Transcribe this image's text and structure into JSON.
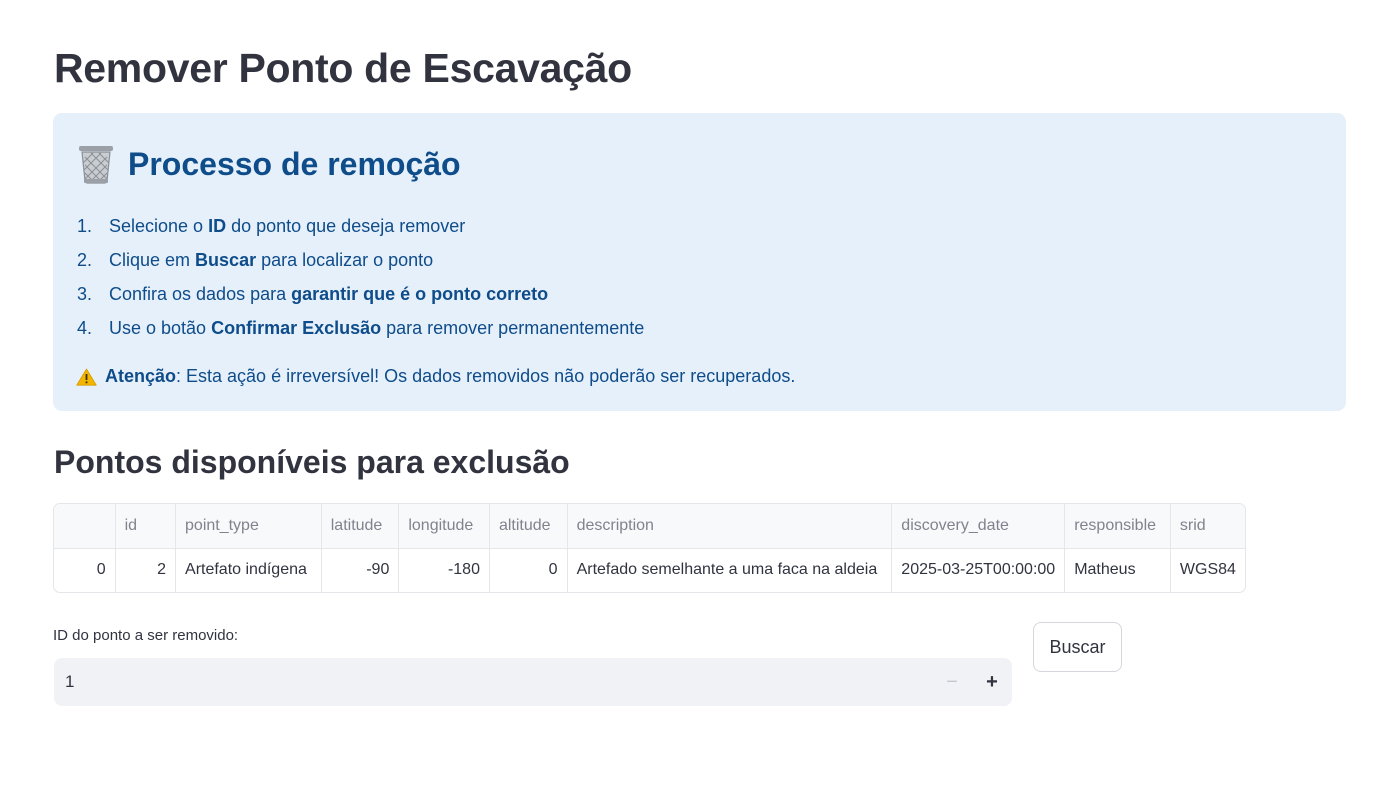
{
  "page": {
    "title": "Remover Ponto de Escavação"
  },
  "info": {
    "icon": "wastebasket-icon",
    "heading": "Processo de remoção",
    "steps": [
      {
        "num": "1.",
        "parts": [
          "Selecione o ",
          "ID",
          " do ponto que deseja remover"
        ]
      },
      {
        "num": "2.",
        "parts": [
          "Clique em ",
          "Buscar",
          " para localizar o ponto"
        ]
      },
      {
        "num": "3.",
        "parts": [
          "Confira os dados para ",
          "garantir que é o ponto correto",
          ""
        ]
      },
      {
        "num": "4.",
        "parts": [
          "Use o botão ",
          "Confirmar Exclusão",
          " para remover permanentemente"
        ]
      }
    ],
    "warning_icon": "warning-icon",
    "warning_bold": "Atenção",
    "warning_text": ": Esta ação é irreversível! Os dados removidos não poderão ser recuperados."
  },
  "section": {
    "title": "Pontos disponíveis para exclusão"
  },
  "table": {
    "columns": [
      "",
      "id",
      "point_type",
      "latitude",
      "longitude",
      "altitude",
      "description",
      "discovery_date",
      "responsible",
      "srid"
    ],
    "rows": [
      [
        "0",
        "2",
        "Artefato indígena",
        "-90",
        "-180",
        "0",
        "Artefado semelhante a uma faca na aldeia",
        "2025-03-25T00:00:00",
        "Matheus",
        "WGS84"
      ]
    ]
  },
  "form": {
    "id_label": "ID do ponto a ser removido:",
    "id_value": "1",
    "minus_label": "−",
    "plus_label": "+",
    "search_button": "Buscar"
  },
  "colors": {
    "info_bg": "#e6f0fb",
    "info_text": "#0e4c8a",
    "text": "#31333f",
    "input_bg": "#f0f2f6"
  }
}
